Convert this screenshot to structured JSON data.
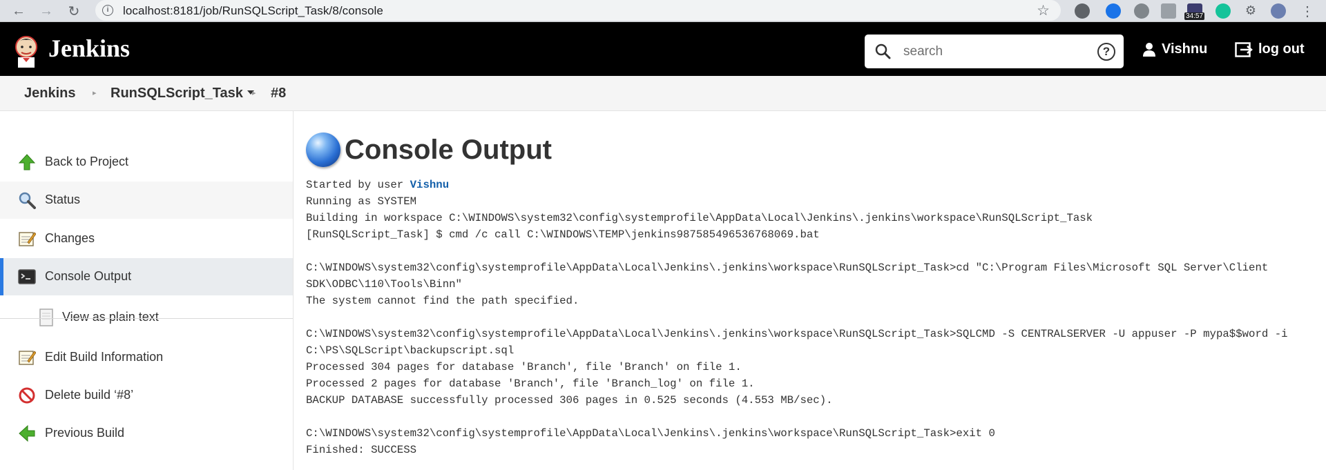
{
  "browser": {
    "url": "localhost:8181/job/RunSQLScript_Task/8/console",
    "badge_time": "34:57"
  },
  "header": {
    "brand": "Jenkins",
    "search_placeholder": "search",
    "help_symbol": "?",
    "user": "Vishnu",
    "logout": "log out"
  },
  "breadcrumb": {
    "items": [
      "Jenkins",
      "RunSQLScript_Task",
      "#8"
    ]
  },
  "sidebar": {
    "items": [
      {
        "label": "Back to Project",
        "icon": "up-arrow-icon"
      },
      {
        "label": "Status",
        "icon": "magnifier-icon"
      },
      {
        "label": "Changes",
        "icon": "notepad-icon"
      },
      {
        "label": "Console Output",
        "icon": "terminal-icon"
      },
      {
        "label": "View as plain text",
        "icon": "document-icon"
      },
      {
        "label": "Edit Build Information",
        "icon": "notepad-icon"
      },
      {
        "label": "Delete build ‘#8’",
        "icon": "no-entry-icon"
      },
      {
        "label": "Previous Build",
        "icon": "left-arrow-icon"
      }
    ]
  },
  "main": {
    "title": "Console Output",
    "started_prefix": "Started by user ",
    "started_user": "Vishnu",
    "lines": [
      "Running as SYSTEM",
      "Building in workspace C:\\WINDOWS\\system32\\config\\systemprofile\\AppData\\Local\\Jenkins\\.jenkins\\workspace\\RunSQLScript_Task",
      "[RunSQLScript_Task] $ cmd /c call C:\\WINDOWS\\TEMP\\jenkins987585496536768069.bat",
      "",
      "C:\\WINDOWS\\system32\\config\\systemprofile\\AppData\\Local\\Jenkins\\.jenkins\\workspace\\RunSQLScript_Task>cd \"C:\\Program Files\\Microsoft SQL Server\\Client",
      "SDK\\ODBC\\110\\Tools\\Binn\"",
      "The system cannot find the path specified.",
      "",
      "C:\\WINDOWS\\system32\\config\\systemprofile\\AppData\\Local\\Jenkins\\.jenkins\\workspace\\RunSQLScript_Task>SQLCMD -S CENTRALSERVER -U appuser -P mypa$$word -i",
      "C:\\PS\\SQLScript\\backupscript.sql",
      "Processed 304 pages for database 'Branch', file 'Branch' on file 1.",
      "Processed 2 pages for database 'Branch', file 'Branch_log' on file 1.",
      "BACKUP DATABASE successfully processed 306 pages in 0.525 seconds (4.553 MB/sec).",
      "",
      "C:\\WINDOWS\\system32\\config\\systemprofile\\AppData\\Local\\Jenkins\\.jenkins\\workspace\\RunSQLScript_Task>exit 0",
      "Finished: SUCCESS"
    ]
  }
}
